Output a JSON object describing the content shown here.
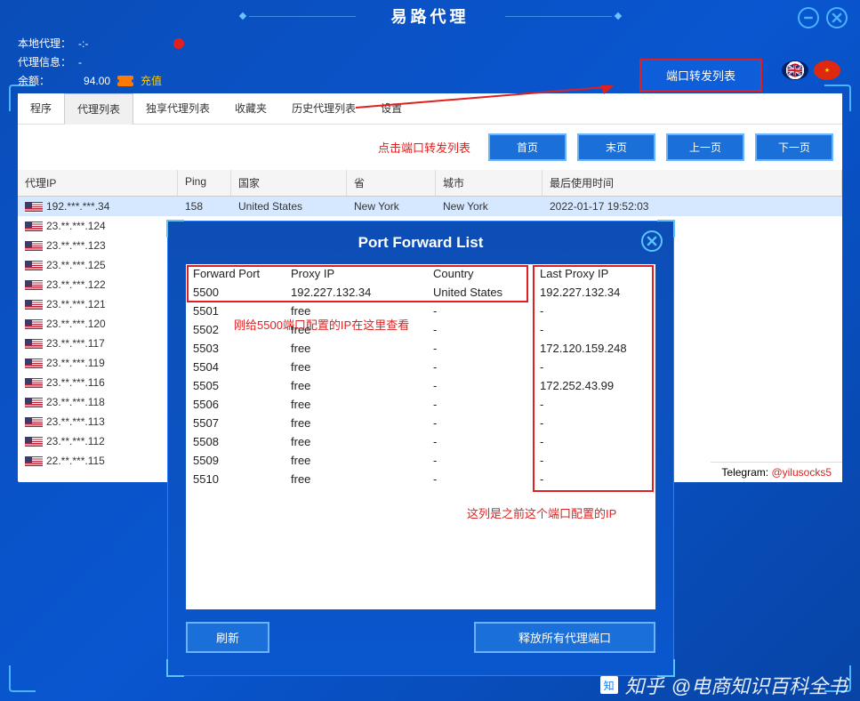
{
  "app": {
    "title": "易路代理"
  },
  "header": {
    "local_proxy_label": "本地代理：",
    "local_proxy_value": "-:-",
    "proxy_info_label": "代理信息：",
    "proxy_info_value": "-",
    "balance_label": "余额：",
    "balance_value": "94.00",
    "recharge": "充值",
    "port_forward_btn": "端口转发列表"
  },
  "tabs": [
    "程序",
    "代理列表",
    "独享代理列表",
    "收藏夹",
    "历史代理列表",
    "设置"
  ],
  "nav": {
    "first": "首页",
    "last": "末页",
    "prev": "上一页",
    "next": "下一页"
  },
  "annot_click": "点击端口转发列表",
  "columns": {
    "ip": "代理IP",
    "ping": "Ping",
    "country": "国家",
    "province": "省",
    "city": "城市",
    "last_used": "最后使用时间"
  },
  "rows": [
    {
      "ip": "192.***.***.34",
      "ping": "158",
      "country": "United States",
      "province": "New York",
      "city": "New York",
      "last_used": "2022-01-17 19:52:03",
      "selected": true
    },
    {
      "ip": "23.**.***.124"
    },
    {
      "ip": "23.**.***.123"
    },
    {
      "ip": "23.**.***.125"
    },
    {
      "ip": "23.**.***.122"
    },
    {
      "ip": "23.**.***.121"
    },
    {
      "ip": "23.**.***.120"
    },
    {
      "ip": "23.**.***.117"
    },
    {
      "ip": "23.**.***.119"
    },
    {
      "ip": "23.**.***.116"
    },
    {
      "ip": "23.**.***.118"
    },
    {
      "ip": "23.**.***.113"
    },
    {
      "ip": "23.**.***.112"
    },
    {
      "ip": "22.**.***.115"
    }
  ],
  "telegram": {
    "label": "Telegram: ",
    "handle": "@yilusocks5"
  },
  "modal": {
    "title": "Port Forward List",
    "cols": {
      "port": "Forward Port",
      "ip": "Proxy IP",
      "country": "Country",
      "last": "Last Proxy IP"
    },
    "rows": [
      {
        "port": "5500",
        "ip": "192.227.132.34",
        "country": "United States",
        "last": "192.227.132.34"
      },
      {
        "port": "5501",
        "ip": "free",
        "country": "-",
        "last": "-"
      },
      {
        "port": "5502",
        "ip": "free",
        "country": "-",
        "last": "-"
      },
      {
        "port": "5503",
        "ip": "free",
        "country": "-",
        "last": "172.120.159.248"
      },
      {
        "port": "5504",
        "ip": "free",
        "country": "-",
        "last": "-"
      },
      {
        "port": "5505",
        "ip": "free",
        "country": "-",
        "last": "172.252.43.99"
      },
      {
        "port": "5506",
        "ip": "free",
        "country": "-",
        "last": "-"
      },
      {
        "port": "5507",
        "ip": "free",
        "country": "-",
        "last": "-"
      },
      {
        "port": "5508",
        "ip": "free",
        "country": "-",
        "last": "-"
      },
      {
        "port": "5509",
        "ip": "free",
        "country": "-",
        "last": "-"
      },
      {
        "port": "5510",
        "ip": "free",
        "country": "-",
        "last": "-"
      }
    ],
    "refresh": "刷新",
    "release_all": "释放所有代理端口",
    "annot1": "刚给5500端口配置的IP在这里查看",
    "annot2": "这列是之前这个端口配置的IP"
  },
  "watermark": {
    "logo": "知",
    "label": "知乎",
    "text": "@电商知识百科全书"
  }
}
